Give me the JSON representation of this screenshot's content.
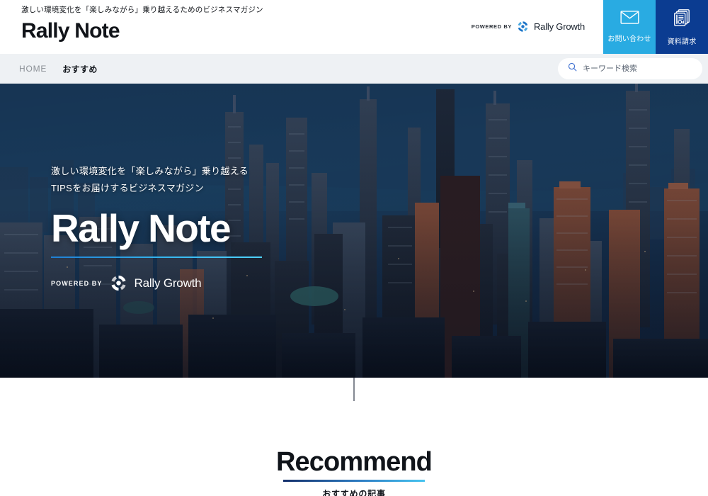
{
  "header": {
    "tagline": "激しい環境変化を「楽しみながら」乗り越えるためのビジネスマガジン",
    "title": "Rally Note",
    "powered_by_label": "POWERED BY",
    "powered_by_name": "Rally Growth",
    "logo_icon": "rally-growth-swirl-icon",
    "cta": [
      {
        "label": "お問い合わせ",
        "icon": "envelope-icon",
        "bg_color": "#29abe2"
      },
      {
        "label": "資料請求",
        "icon": "documents-icon",
        "bg_color": "#0b3c91"
      }
    ]
  },
  "nav": {
    "bg_color": "#eef1f4",
    "links": [
      {
        "label": "HOME",
        "active": false
      },
      {
        "label": "おすすめ",
        "active": true
      }
    ],
    "search": {
      "placeholder": "キーワード検索",
      "value": "",
      "icon": "search-icon",
      "icon_color": "#3d6fd0"
    }
  },
  "hero": {
    "lead_line1": "激しい環境変化を「楽しみながら」乗り越える",
    "lead_line2": "TIPSをお届けするビジネスマガジン",
    "title": "Rally Note",
    "powered_by_label": "POWERED BY",
    "powered_by_name": "Rally Growth",
    "logo_icon": "rally-growth-swirl-icon",
    "rule_gradient_from": "#1f7fd4",
    "rule_gradient_to": "#4fd2ff",
    "image_alt": "夜明けの都市ビル群の空撮写真"
  },
  "recommend": {
    "title": "Recommend",
    "subtitle": "おすすめの記事",
    "rule_gradient_from": "#14306b",
    "rule_gradient_to": "#46c4f0"
  }
}
